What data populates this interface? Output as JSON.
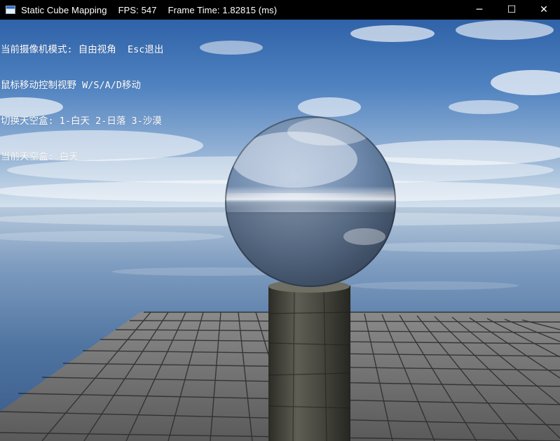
{
  "window": {
    "title": "Static Cube Mapping",
    "fps_label": "FPS: 547",
    "frame_time_label": "Frame Time: 1.82815 (ms)",
    "controls": {
      "minimize": "─",
      "maximize": "☐",
      "close": "✕"
    }
  },
  "hud": {
    "lines": [
      "当前摄像机模式: 自由视角  Esc退出",
      "鼠标移动控制视野 W/S/A/D移动",
      "切换天空盒: 1-白天 2-日落 3-沙漠",
      "当前天空盒: 白天"
    ]
  },
  "scene": {
    "sky_top_color": "#2f62a8",
    "sky_horizon_color": "#c9d9ea",
    "water_color": "#4a6f98",
    "floor_color": "#6b6b6b",
    "pillar_color": "#4a4a42",
    "sphere_reflection": "chrome"
  }
}
